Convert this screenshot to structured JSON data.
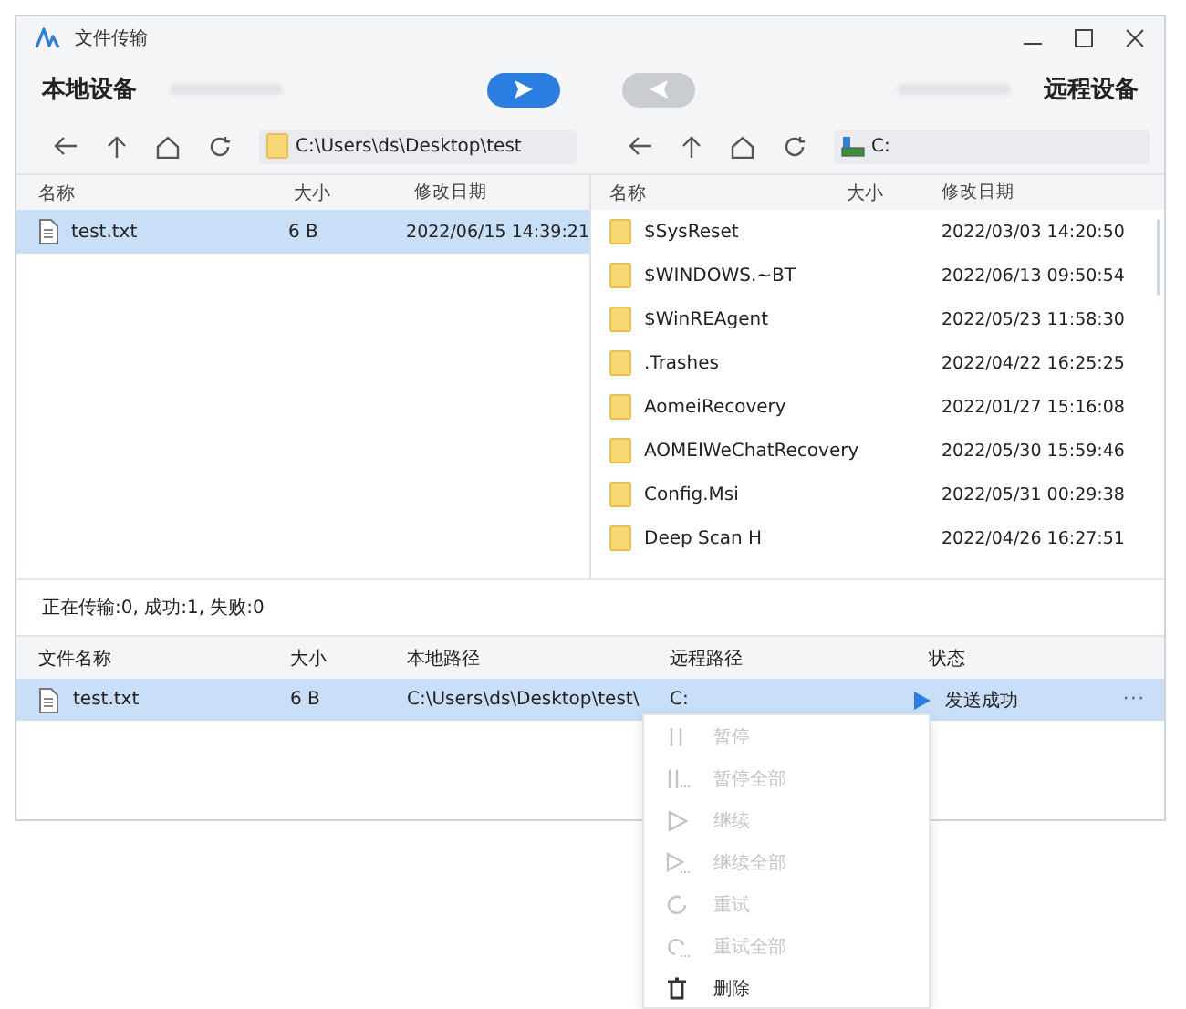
{
  "window": {
    "title": "文件传输"
  },
  "local": {
    "label": "本地设备",
    "path": "C:\\Users\\ds\\Desktop\\test"
  },
  "remote": {
    "label": "远程设备",
    "path": "C:"
  },
  "transfer_buttons": [
    {
      "kind": "send",
      "disabled": false
    },
    {
      "kind": "receive",
      "disabled": true
    }
  ],
  "local_files": {
    "columns": [
      "名称",
      "大小",
      "修改日期"
    ],
    "rows": [
      {
        "name": "test.txt",
        "size": "6 B",
        "modified": "2022/06/15 14:39:21",
        "kind": "file",
        "selected": true
      }
    ]
  },
  "remote_files": {
    "columns": [
      "名称",
      "大小",
      "修改日期"
    ],
    "rows": [
      {
        "name": "$SysReset",
        "modified": "2022/03/03 14:20:50",
        "kind": "folder",
        "selected": false
      },
      {
        "name": "$WINDOWS.~BT",
        "modified": "2022/06/13 09:50:54",
        "kind": "folder",
        "selected": false
      },
      {
        "name": "$WinREAgent",
        "modified": "2022/05/23 11:58:30",
        "kind": "folder",
        "selected": false
      },
      {
        "name": ".Trashes",
        "modified": "2022/04/22 16:25:25",
        "kind": "folder",
        "selected": false
      },
      {
        "name": "AomeiRecovery",
        "modified": "2022/01/27 15:16:08",
        "kind": "folder",
        "selected": false
      },
      {
        "name": "AOMEIWeChatRecovery",
        "modified": "2022/05/30 15:59:46",
        "kind": "folder",
        "selected": false
      },
      {
        "name": "Config.Msi",
        "modified": "2022/05/31 00:29:38",
        "kind": "folder",
        "selected": false
      },
      {
        "name": "Deep Scan H",
        "modified": "2022/04/26 16:27:51",
        "kind": "folder",
        "selected": false
      }
    ]
  },
  "status_summary": "正在传输:0, 成功:1, 失败:0",
  "transfers": {
    "columns": [
      "文件名称",
      "大小",
      "本地路径",
      "远程路径",
      "状态"
    ],
    "rows": [
      {
        "name": "test.txt",
        "size": "6 B",
        "local_path": "C:\\Users\\ds\\Desktop\\test\\",
        "remote_path": "C:",
        "status": "发送成功",
        "more": "···",
        "selected": true
      }
    ]
  },
  "context_menu": {
    "items": [
      {
        "label": "暂停",
        "kind": "pause",
        "disabled": true
      },
      {
        "label": "暂停全部",
        "kind": "pause-all",
        "disabled": true
      },
      {
        "label": "继续",
        "kind": "play",
        "disabled": true
      },
      {
        "label": "继续全部",
        "kind": "play-all",
        "disabled": true
      },
      {
        "label": "重试",
        "kind": "retry",
        "disabled": true
      },
      {
        "label": "重试全部",
        "kind": "retry-all",
        "disabled": true
      },
      {
        "label": "删除",
        "kind": "delete",
        "disabled": false
      }
    ]
  }
}
